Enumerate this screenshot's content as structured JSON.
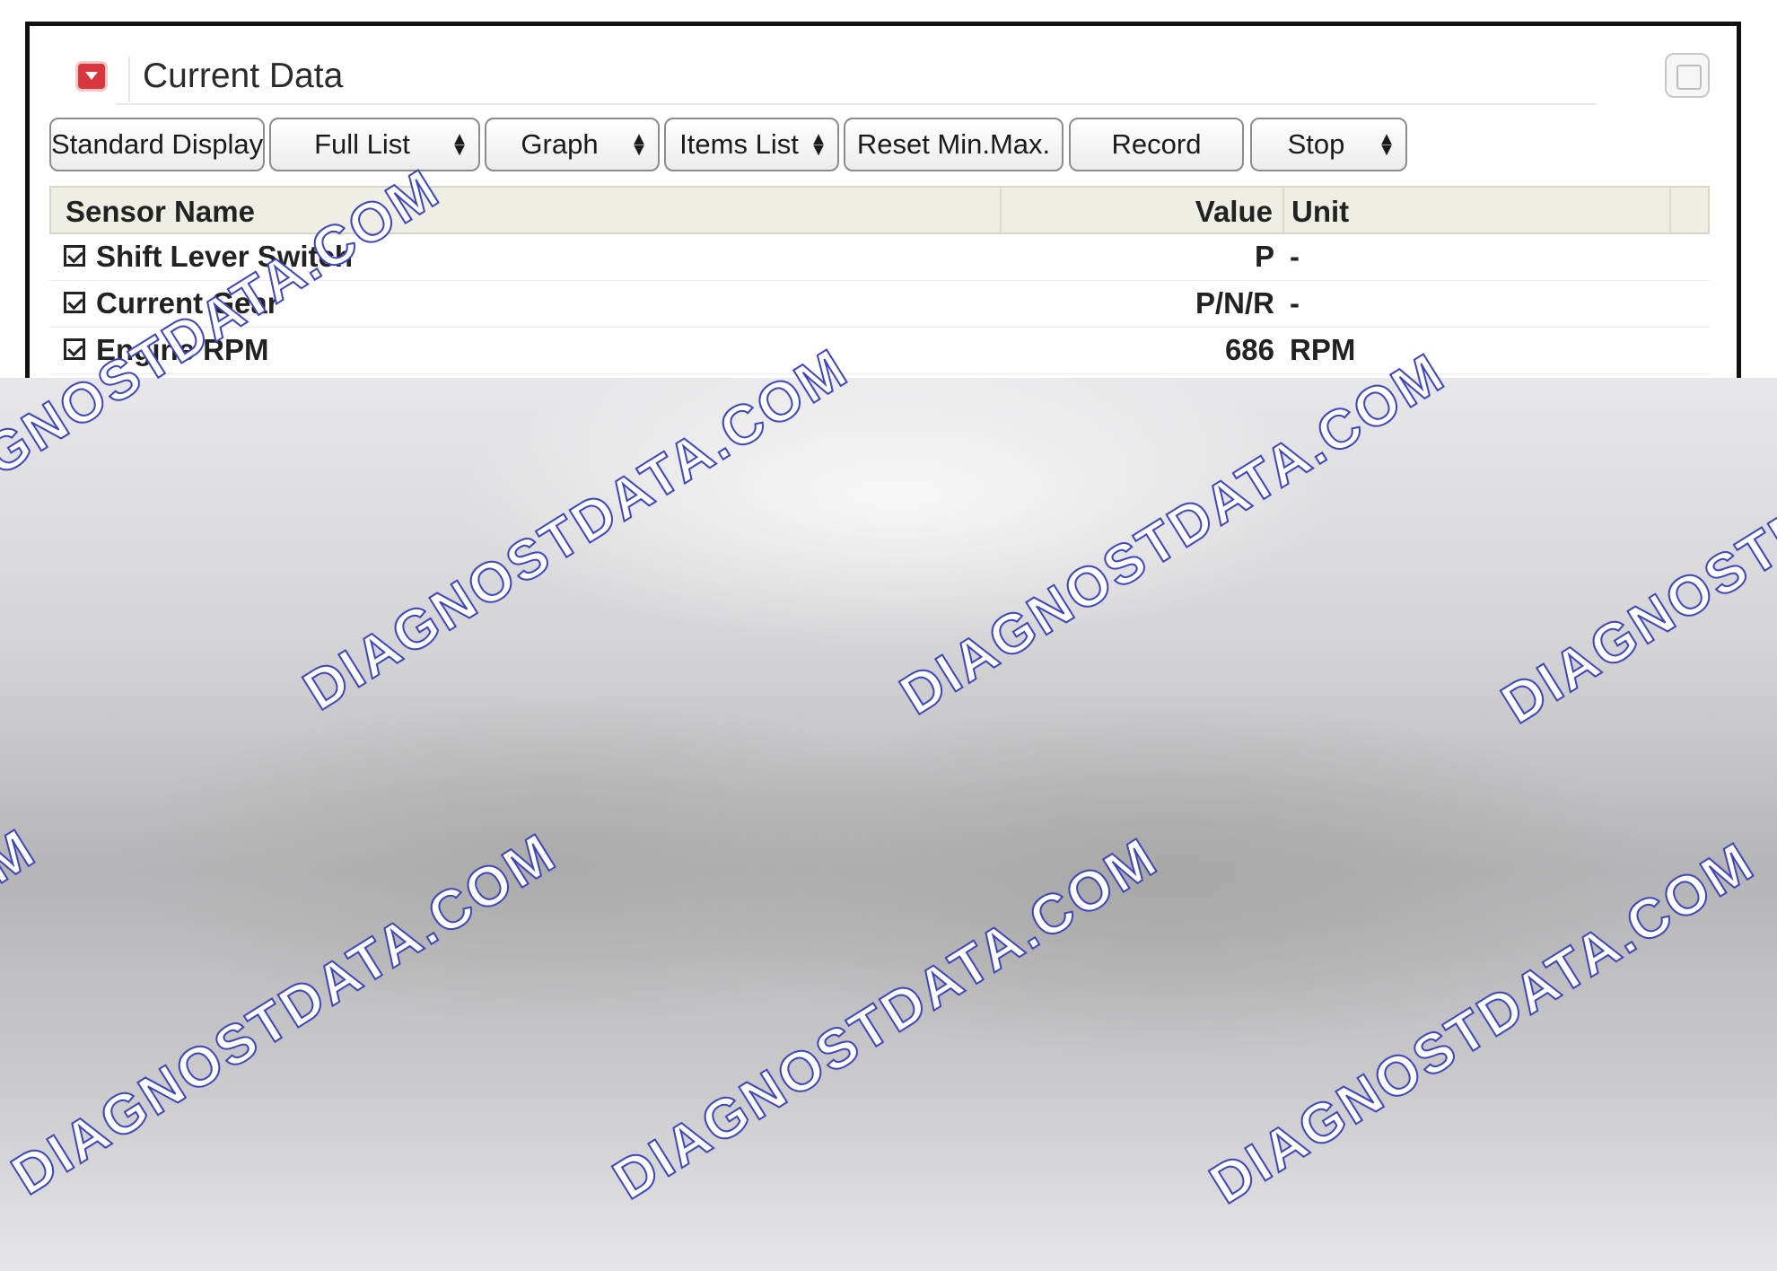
{
  "window": {
    "title": "Current Data"
  },
  "toolbar": {
    "buttons": [
      {
        "label": "Standard Display",
        "dropdown": true
      },
      {
        "label": "Full List",
        "dropdown": true
      },
      {
        "label": "Graph",
        "dropdown": true
      },
      {
        "label": "Items List",
        "dropdown": true
      },
      {
        "label": "Reset Min.Max.",
        "dropdown": false
      },
      {
        "label": "Record",
        "dropdown": false
      },
      {
        "label": "Stop",
        "dropdown": true
      }
    ]
  },
  "table": {
    "columns": [
      "Sensor Name",
      "Value",
      "Unit"
    ],
    "rows": [
      {
        "checked": true,
        "name": "Shift Lever Switch",
        "value": "P",
        "unit": "-"
      },
      {
        "checked": true,
        "name": "Current Gear",
        "value": "P/N/R",
        "unit": "-"
      },
      {
        "checked": true,
        "name": "Engine RPM",
        "value": "686",
        "unit": "RPM"
      }
    ]
  },
  "watermark": {
    "text": "DIAGNOSTDATA.COM",
    "color": "#3f47b8"
  }
}
